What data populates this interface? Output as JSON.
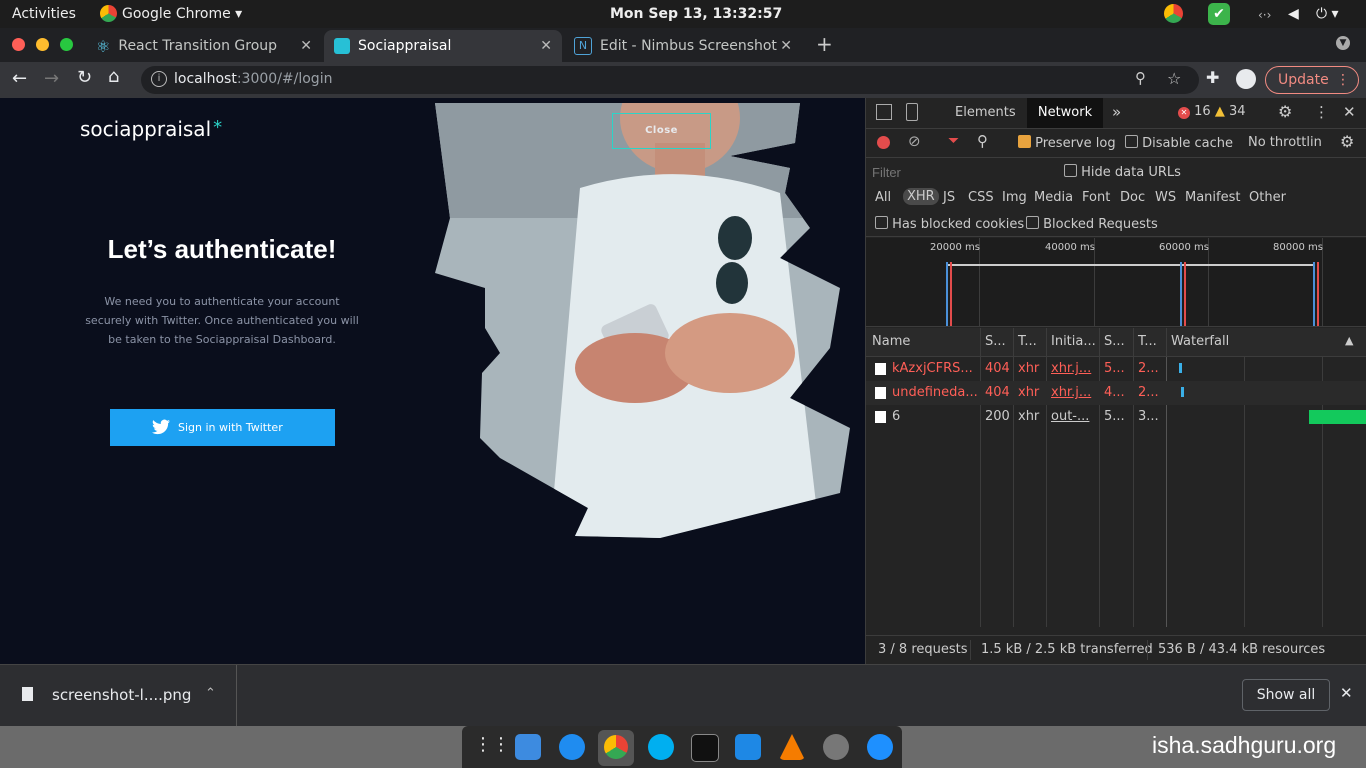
{
  "topbar": {
    "activities": "Activities",
    "app": "Google Chrome",
    "clock": "Mon Sep 13, 13:32:57"
  },
  "tabs": [
    {
      "title": "React Transition Group",
      "active": false
    },
    {
      "title": "Sociappraisal",
      "active": true
    },
    {
      "title": "Edit - Nimbus Screenshot",
      "active": false
    }
  ],
  "toolbar": {
    "url_host": "localhost",
    "url_rest": ":3000/#/login",
    "update_label": "Update"
  },
  "page": {
    "logo": "sociappraisal",
    "logo_mark": "*",
    "close_label": "Close",
    "heading": "Let’s authenticate!",
    "body": "We need you to authenticate your account securely with Twitter. Once authenticated you will be taken to the Sociappraisal Dashboard.",
    "signin_label": "Sign in with Twitter"
  },
  "devtools": {
    "tabs": [
      "Elements",
      "Network"
    ],
    "active_tab": "Network",
    "errors": "16",
    "warnings": "34",
    "preserve_log": "Preserve log",
    "disable_cache": "Disable cache",
    "throttling": "No throttlin",
    "filter_placeholder": "Filter",
    "hide_data_urls": "Hide data URLs",
    "types": [
      "All",
      "XHR",
      "JS",
      "CSS",
      "Img",
      "Media",
      "Font",
      "Doc",
      "WS",
      "Manifest",
      "Other"
    ],
    "active_type": "XHR",
    "blocked_cookies": "Has blocked cookies",
    "blocked_requests": "Blocked Requests",
    "timeline_ticks": [
      "20000 ms",
      "40000 ms",
      "60000 ms",
      "80000 ms"
    ],
    "columns": [
      "Name",
      "S...",
      "T...",
      "Initia...",
      "S...",
      "T...",
      "Waterfall"
    ],
    "rows": [
      {
        "name": "kAzxjCFRS...",
        "status": "404",
        "type": "xhr",
        "initiator": "xhr.j...",
        "size": "5...",
        "time": "2...",
        "error": true
      },
      {
        "name": "undefineda...",
        "status": "404",
        "type": "xhr",
        "initiator": "xhr.j...",
        "size": "4...",
        "time": "2...",
        "error": true
      },
      {
        "name": "6",
        "status": "200",
        "type": "xhr",
        "initiator": "out-...",
        "size": "5...",
        "time": "3...",
        "error": false
      }
    ],
    "status_requests": "3 / 8 requests",
    "status_transferred": "1.5 kB / 2.5 kB transferred",
    "status_resources": "536 B / 43.4 kB resources"
  },
  "downloads": {
    "file": "screenshot-l....png",
    "show_all": "Show all"
  },
  "dock": {
    "watermark": "isha.sadhguru.org"
  },
  "colors": {
    "accent": "#1da1f2",
    "page_bg": "#0a0e1c",
    "error": "#ff5f57",
    "update": "#f28b82"
  }
}
